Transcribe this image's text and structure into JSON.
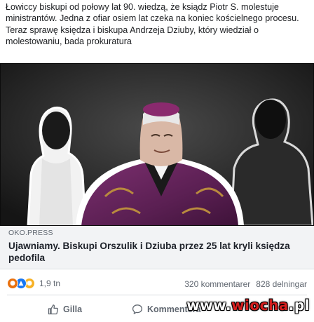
{
  "post": {
    "text": "Łowiccy biskupi od połowy lat 90. wiedzą, że ksiądz Piotr S. molestuje ministrantów. Jedna z ofiar osiem lat czeka na koniec kościelnego procesu. Teraz sprawę księdza i biskupa Andrzeja Dziuby, który wiedział o molestowaniu, bada prokuratura"
  },
  "link_card": {
    "source": "OKO.PRESS",
    "title": "Ujawniamy. Biskupi Orszulik i Dziuba przez 25 lat kryli księdza pedofila"
  },
  "stats": {
    "reaction_icons": [
      "angry-icon",
      "like-icon",
      "sad-icon"
    ],
    "reaction_count": "1,9 tn",
    "comments": "320 kommentarer",
    "shares": "828 delningar"
  },
  "actions": {
    "like_label": "Gilla",
    "comment_label": "Kommentera"
  },
  "watermark": {
    "prefix": "www.",
    "brand": "wiocha",
    "suffix": ".pl"
  },
  "colors": {
    "background": "#ffffff",
    "link_card_bg": "#f2f3f5",
    "secondary_text": "#606770",
    "like_blue": "#1877f2",
    "angry_orange": "#e9710f",
    "sad_yellow": "#f7b125",
    "watermark_red": "#d41f1f"
  }
}
